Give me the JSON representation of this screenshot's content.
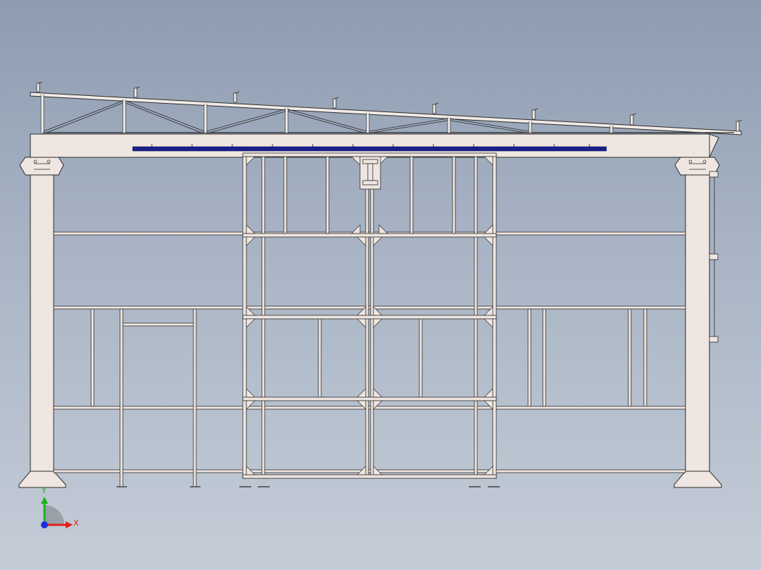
{
  "app": {
    "view": "front-view"
  },
  "triad": {
    "x_label": "X",
    "y_label": "Y",
    "x_color": "#e0201a",
    "y_color": "#1bb31b",
    "z_color": "#1a2ee0"
  },
  "colors": {
    "steel_fill": "#efe6e1",
    "steel_stroke": "#2a2a2a",
    "highlight_beam": "#1a1f8c",
    "background_top": "#8e9cb1",
    "background_bottom": "#c4ccd7"
  }
}
